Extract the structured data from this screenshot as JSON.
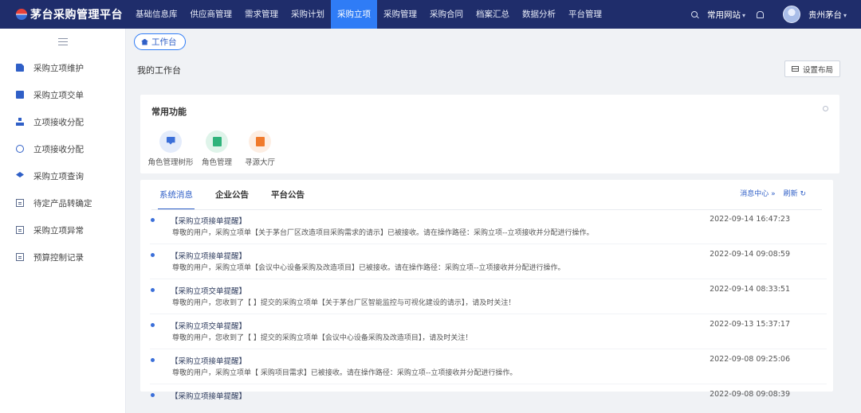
{
  "brand": {
    "name": "茅台采购管理平台"
  },
  "nav": {
    "items": [
      "基础信息库",
      "供应商管理",
      "需求管理",
      "采购计划",
      "采购立项",
      "采购管理",
      "采购合同",
      "档案汇总",
      "数据分析",
      "平台管理"
    ],
    "active_index": 4
  },
  "top_right": {
    "common_sites": "常用网站",
    "user_name": "贵州茅台"
  },
  "sidebar": {
    "items": [
      "采购立项维护",
      "采购立项交单",
      "立项接收分配",
      "立项接收分配",
      "采购立项查询",
      "待定产品转确定",
      "采购立项异常",
      "预算控制记录"
    ]
  },
  "breadcrumb": {
    "label": "工作台"
  },
  "page": {
    "title": "我的工作台",
    "layout_button": "设置布局"
  },
  "functions": {
    "title": "常用功能",
    "items": [
      {
        "label": "角色管理树形",
        "icon": "download-icon",
        "color": "#3b6fd9"
      },
      {
        "label": "角色管理",
        "icon": "document-icon",
        "color": "#2fb37b"
      },
      {
        "label": "寻源大厅",
        "icon": "document-icon",
        "color": "#f07a2c"
      }
    ]
  },
  "messages": {
    "tabs": [
      "系统消息",
      "企业公告",
      "平台公告"
    ],
    "active_tab": 0,
    "center_link": "消息中心 »",
    "refresh_link": "刷新 ↻",
    "list": [
      {
        "title": "【采购立项接单提醒】",
        "body": "尊敬的用户，采购立项单【关于茅台厂区改造项目采购需求的请示】已被接收。请在操作路径：采购立项--立项接收并分配进行操作。",
        "time": "2022-09-14 16:47:23"
      },
      {
        "title": "【采购立项接单提醒】",
        "body": "尊敬的用户，采购立项单【会议中心设备采购及改造项目】已被接收。请在操作路径：采购立项--立项接收并分配进行操作。",
        "time": "2022-09-14 09:08:59"
      },
      {
        "title": "【采购立项交单提醒】",
        "body": "尊敬的用户，您收到了【        】提交的采购立项单【关于茅台厂区智能监控与可视化建设的请示】，请及时关注！",
        "time": "2022-09-14 08:33:51"
      },
      {
        "title": "【采购立项交单提醒】",
        "body": "尊敬的用户，您收到了【        】提交的采购立项单【会议中心设备采购及改造项目】，请及时关注！",
        "time": "2022-09-13 15:37:17"
      },
      {
        "title": "【采购立项接单提醒】",
        "body": "尊敬的用户，采购立项单【                    采购项目需求】已被接收。请在操作路径：采购立项--立项接收并分配进行操作。",
        "time": "2022-09-08 09:25:06"
      },
      {
        "title": "【采购立项接单提醒】",
        "body": "",
        "time": "2022-09-08 09:08:39"
      }
    ]
  }
}
